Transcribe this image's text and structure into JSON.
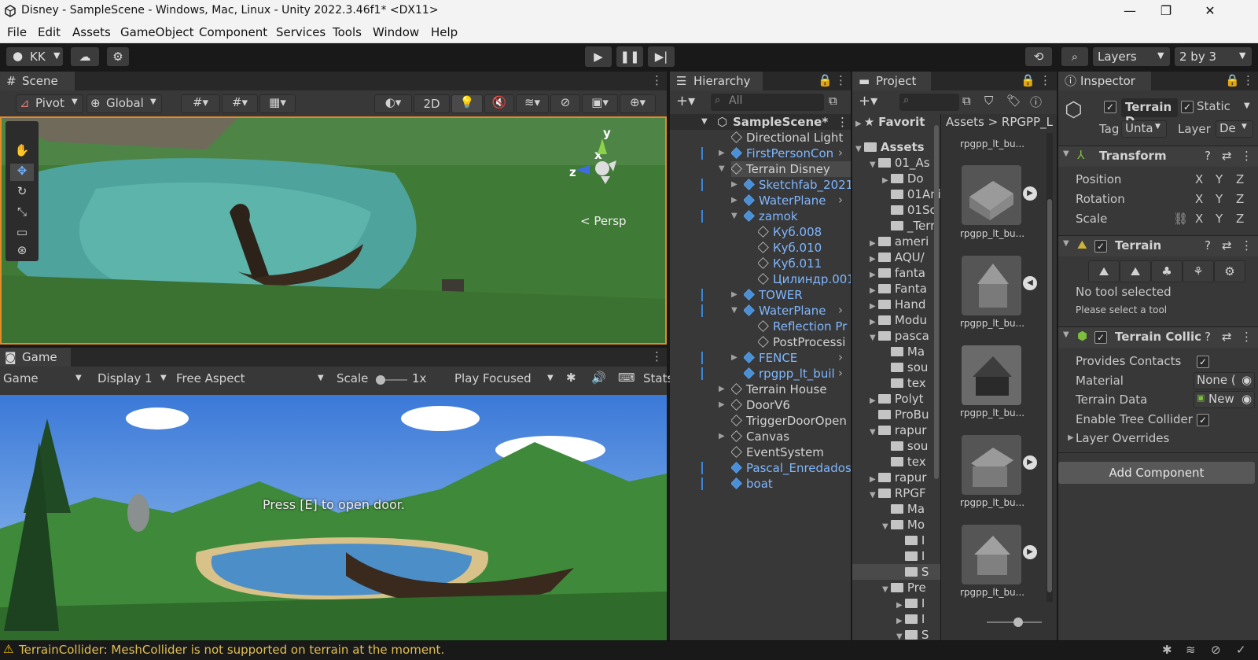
{
  "window": {
    "title": "Disney - SampleScene - Windows, Mac, Linux - Unity 2022.3.46f1* <DX11>",
    "min": "—",
    "max": "❐",
    "close": "✕"
  },
  "menu": [
    "File",
    "Edit",
    "Assets",
    "GameObject",
    "Component",
    "Services",
    "Tools",
    "Window",
    "Help"
  ],
  "toolbar": {
    "account": "KK",
    "layers": "Layers",
    "layout": "2 by 3"
  },
  "scene": {
    "tab": "Scene",
    "pivot": "Pivot",
    "global": "Global",
    "mode2d": "2D",
    "persp": "< Persp",
    "gizmo_y": "y",
    "gizmo_x": "x",
    "gizmo_z": "z"
  },
  "game": {
    "tab": "Game",
    "dropdown": "Game",
    "display": "Display 1",
    "aspect": "Free Aspect",
    "scale_label": "Scale",
    "scale_value": "1x",
    "play_focused": "Play Focused",
    "stats": "Stats",
    "overlay_text": "Press [E] to open door."
  },
  "hierarchy": {
    "tab": "Hierarchy",
    "search_placeholder": "All",
    "items": [
      {
        "label": "SampleScene*"
      },
      {
        "label": "Directional Light"
      },
      {
        "label": "FirstPersonCon"
      },
      {
        "label": "Terrain Disney"
      },
      {
        "label": "Sketchfab_2021"
      },
      {
        "label": "WaterPlane"
      },
      {
        "label": "zamok"
      },
      {
        "label": "Куб.008"
      },
      {
        "label": "Куб.010"
      },
      {
        "label": "Куб.011"
      },
      {
        "label": "Цилиндр.001"
      },
      {
        "label": "TOWER"
      },
      {
        "label": "WaterPlane"
      },
      {
        "label": "Reflection Pr"
      },
      {
        "label": "PostProcessi"
      },
      {
        "label": "FENCE"
      },
      {
        "label": "rpgpp_lt_buil"
      },
      {
        "label": "Terrain House"
      },
      {
        "label": "DoorV6"
      },
      {
        "label": "TriggerDoorOpen"
      },
      {
        "label": "Canvas"
      },
      {
        "label": "EventSystem"
      },
      {
        "label": "Pascal_Enredados"
      },
      {
        "label": "boat"
      }
    ]
  },
  "project": {
    "tab": "Project",
    "favorites": "Favorit",
    "breadcrumb": "Assets  >  RPGPP_L",
    "tree": [
      {
        "label": "Assets"
      },
      {
        "label": "01_As"
      },
      {
        "label": "Do"
      },
      {
        "label": "01Ani"
      },
      {
        "label": "01Sc"
      },
      {
        "label": "_Terr"
      },
      {
        "label": "ameri"
      },
      {
        "label": "AQU/"
      },
      {
        "label": "fanta"
      },
      {
        "label": "Fanta"
      },
      {
        "label": "Hand"
      },
      {
        "label": "Modu"
      },
      {
        "label": "pasca"
      },
      {
        "label": "Ma"
      },
      {
        "label": "sou"
      },
      {
        "label": "tex"
      },
      {
        "label": "Polyt"
      },
      {
        "label": "ProBu"
      },
      {
        "label": "rapur"
      },
      {
        "label": "sou"
      },
      {
        "label": "tex"
      },
      {
        "label": "rapur"
      },
      {
        "label": "RPGF"
      },
      {
        "label": "Ma"
      },
      {
        "label": "Mo"
      },
      {
        "label": "I"
      },
      {
        "label": "I"
      },
      {
        "label": "S"
      },
      {
        "label": "Pre"
      },
      {
        "label": "I"
      },
      {
        "label": "I"
      },
      {
        "label": "S"
      }
    ],
    "assets": [
      "rpgpp_lt_bu...",
      "rpgpp_lt_bu...",
      "rpgpp_lt_bu...",
      "rpgpp_lt_bu...",
      "rpgpp_lt_bu...",
      "rpgpp_lt_bu..."
    ]
  },
  "inspector": {
    "tab": "Inspector",
    "object_name": "Terrain D",
    "static": "Static",
    "tag_label": "Tag",
    "tag_value": "Unta",
    "layer_label": "Layer",
    "layer_value": "De",
    "transform": {
      "title": "Transform",
      "position": "Position",
      "rotation": "Rotation",
      "scale": "Scale",
      "x": "X",
      "y": "Y",
      "z": "Z"
    },
    "terrain": {
      "title": "Terrain",
      "no_tool": "No tool selected",
      "hint": "Please select a tool"
    },
    "collider": {
      "title": "Terrain Collic",
      "provides_contacts": "Provides Contacts",
      "material": "Material",
      "material_value": "None (",
      "terrain_data": "Terrain Data",
      "terrain_data_value": "New",
      "enable_tree": "Enable Tree Collider",
      "layer_overrides": "Layer Overrides"
    },
    "add_component": "Add Component"
  },
  "status": {
    "message": "TerrainCollider: MeshCollider is not supported on terrain at the moment."
  },
  "colors": {
    "accent": "#3a86d9",
    "warning": "#f2c200",
    "scene_frame": "#e28b29"
  }
}
